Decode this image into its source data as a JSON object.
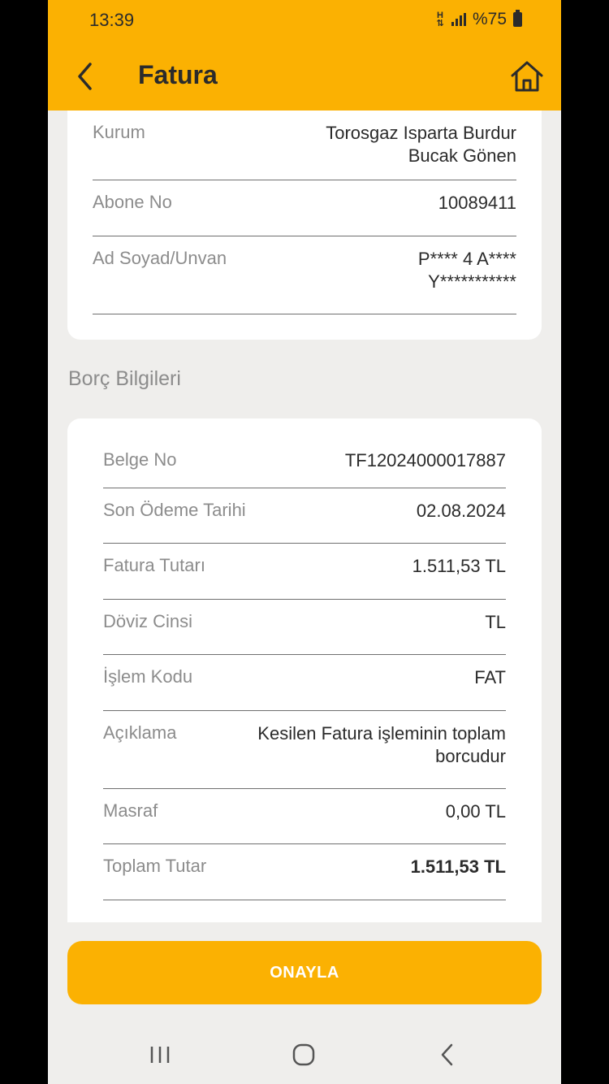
{
  "status_bar": {
    "time": "13:39",
    "network": "H",
    "battery": "%75"
  },
  "header": {
    "title": "Fatura"
  },
  "subscriber": {
    "rows": [
      {
        "label": "Kurum",
        "value": "Torosgaz Isparta Burdur Bucak Gönen"
      },
      {
        "label": "Abone No",
        "value": "10089411"
      },
      {
        "label": "Ad Soyad/Unvan",
        "value": "P**** 4 A**** Y***********"
      }
    ]
  },
  "debt_section": {
    "title": "Borç Bilgileri",
    "rows": [
      {
        "label": "Belge No",
        "value": "TF12024000017887"
      },
      {
        "label": "Son Ödeme Tarihi",
        "value": "02.08.2024"
      },
      {
        "label": "Fatura Tutarı",
        "value": "1.511,53 TL"
      },
      {
        "label": "Döviz Cinsi",
        "value": "TL"
      },
      {
        "label": "İşlem Kodu",
        "value": "FAT"
      },
      {
        "label": "Açıklama",
        "value": "Kesilen Fatura işleminin toplam borcudur"
      },
      {
        "label": "Masraf",
        "value": "0,00 TL"
      },
      {
        "label": "Toplam Tutar",
        "value": "1.511,53 TL"
      }
    ]
  },
  "actions": {
    "confirm_label": "ONAYLA"
  },
  "icons": {
    "back": "chevron-left-icon",
    "home": "home-icon",
    "nav_recents": "recents-icon",
    "nav_home": "nav-home-icon",
    "nav_back": "nav-back-icon"
  },
  "colors": {
    "accent": "#fbb102",
    "background": "#efeeec",
    "card": "#ffffff"
  }
}
